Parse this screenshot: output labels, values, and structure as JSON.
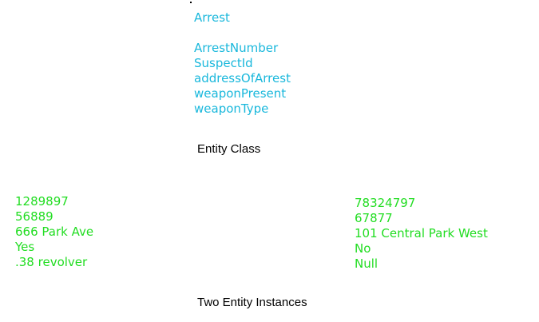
{
  "entity_class": {
    "name": "Arrest",
    "attributes": [
      "ArrestNumber",
      "SuspectId",
      "addressOfArrest",
      "weaponPresent",
      "weaponType"
    ],
    "caption": "Entity Class"
  },
  "instances": [
    [
      "1289897",
      "56889",
      "666 Park Ave",
      "Yes",
      ".38 revolver"
    ],
    [
      "78324797",
      "67877",
      "101 Central Park West",
      "No",
      "Null"
    ]
  ],
  "instances_caption": "Two Entity Instances",
  "colors": {
    "class_text": "#1ab8dc",
    "instance_text": "#22dd22",
    "caption_text": "#000000"
  }
}
